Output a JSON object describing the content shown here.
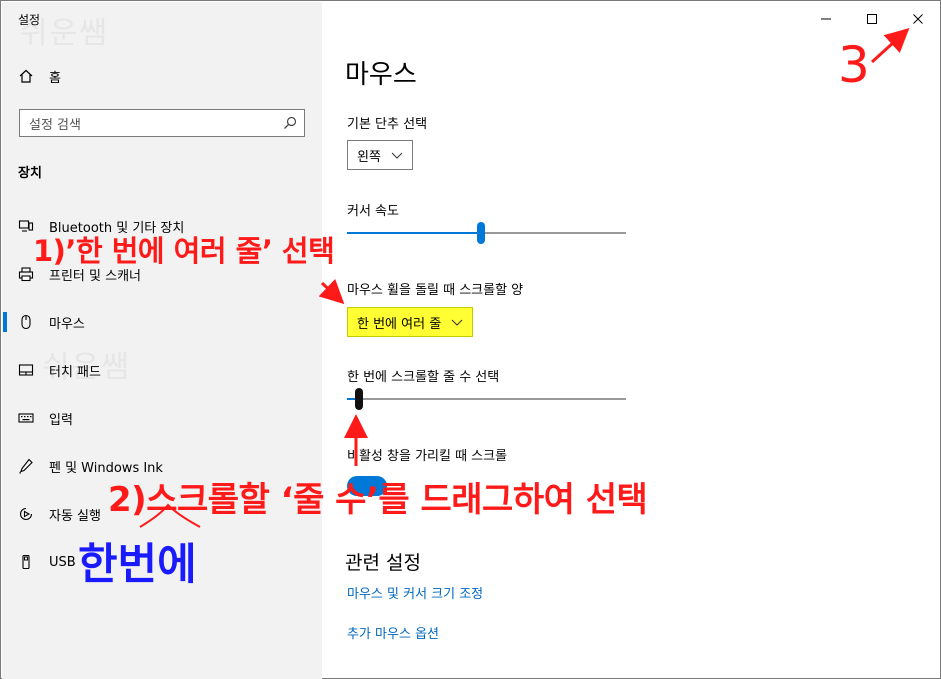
{
  "window": {
    "title": "설정"
  },
  "watermark": "쉬운쌤",
  "sidebar": {
    "home_label": "홈",
    "search_placeholder": "설정 검색",
    "section": "장치",
    "items": [
      {
        "label": "Bluetooth 및 기타 장치",
        "icon": "bluetooth-icon"
      },
      {
        "label": "프린터 및 스캐너",
        "icon": "printer-icon"
      },
      {
        "label": "마우스",
        "icon": "mouse-icon",
        "selected": true
      },
      {
        "label": "터치 패드",
        "icon": "touchpad-icon"
      },
      {
        "label": "입력",
        "icon": "keyboard-icon"
      },
      {
        "label": "펜 및 Windows Ink",
        "icon": "pen-icon"
      },
      {
        "label": "자동 실행",
        "icon": "autoplay-icon"
      },
      {
        "label": "USB",
        "icon": "usb-icon"
      }
    ]
  },
  "main": {
    "title": "마우스",
    "primary_button_label": "기본 단추 선택",
    "primary_button_value": "왼쪽",
    "cursor_speed_label": "커서 속도",
    "cursor_speed_value": 0.48,
    "wheel_label": "마우스 휠을 돌릴 때 스크롤할 양",
    "wheel_value": "한 번에 여러 줄",
    "lines_label": "한 번에 스크롤할 줄 수 선택",
    "lines_value": 0.03,
    "inactive_label": "비활성 창을 가리킬 때 스크롤",
    "related_title": "관련 설정",
    "links": [
      "마우스 및 커서 크기 조정",
      "추가 마우스 옵션"
    ]
  },
  "annotations": {
    "step1": "1)’한 번에 여러 줄’ 선택",
    "step2": "2)스크롤할 ‘줄 수’를 드래그하여 선택",
    "step3": "3",
    "hint": "한번에"
  },
  "colors": {
    "accent": "#0078d7",
    "link": "#0067c0",
    "annotation_red": "#ff1a1a",
    "annotation_blue": "#1a1aff",
    "highlight": "#ffff33"
  }
}
